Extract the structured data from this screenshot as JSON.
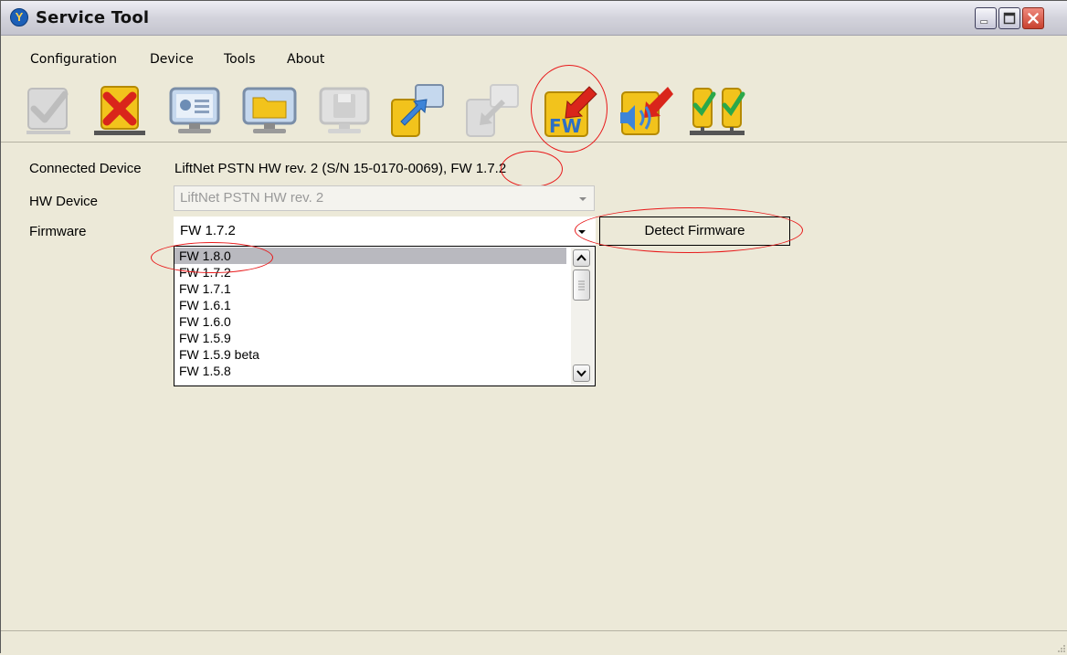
{
  "window": {
    "title": "Service Tool",
    "app_icon": "app-logo-icon"
  },
  "menu": [
    {
      "label": "Configuration"
    },
    {
      "label": "Device"
    },
    {
      "label": "Tools"
    },
    {
      "label": "About"
    }
  ],
  "toolbar": [
    {
      "icon": "check-icon",
      "enabled": false
    },
    {
      "icon": "disconnect-icon",
      "enabled": true
    },
    {
      "icon": "device-settings-icon",
      "enabled": true
    },
    {
      "icon": "open-folder-icon",
      "enabled": true
    },
    {
      "icon": "save-icon",
      "enabled": false
    },
    {
      "icon": "upload-to-pc-icon",
      "enabled": true
    },
    {
      "icon": "download-icon",
      "enabled": false
    },
    {
      "icon": "firmware-update-icon",
      "enabled": true,
      "badge": "FW"
    },
    {
      "icon": "voice-update-icon",
      "enabled": true
    },
    {
      "icon": "network-check-icon",
      "enabled": true
    }
  ],
  "form": {
    "connected_device_label": "Connected Device",
    "connected_device_value": "LiftNet PSTN HW rev. 2 (S/N 15-0170-0069), FW 1.7.2",
    "hw_device_label": "HW Device",
    "hw_device_value": "LiftNet PSTN HW rev. 2",
    "firmware_label": "Firmware",
    "firmware_value": "FW 1.7.2",
    "detect_button": "Detect Firmware"
  },
  "firmware_options": [
    {
      "label": "FW 1.8.0",
      "selected": true
    },
    {
      "label": "FW 1.7.2",
      "selected": false
    },
    {
      "label": "FW 1.7.1",
      "selected": false
    },
    {
      "label": "FW 1.6.1",
      "selected": false
    },
    {
      "label": "FW 1.6.0",
      "selected": false
    },
    {
      "label": "FW 1.5.9",
      "selected": false
    },
    {
      "label": "FW 1.5.9 beta",
      "selected": false
    },
    {
      "label": "FW 1.5.8",
      "selected": false
    }
  ],
  "colors": {
    "annotation": "#e8191a",
    "selection": "#b9b9bf",
    "window_bg": "#ece9d8"
  }
}
